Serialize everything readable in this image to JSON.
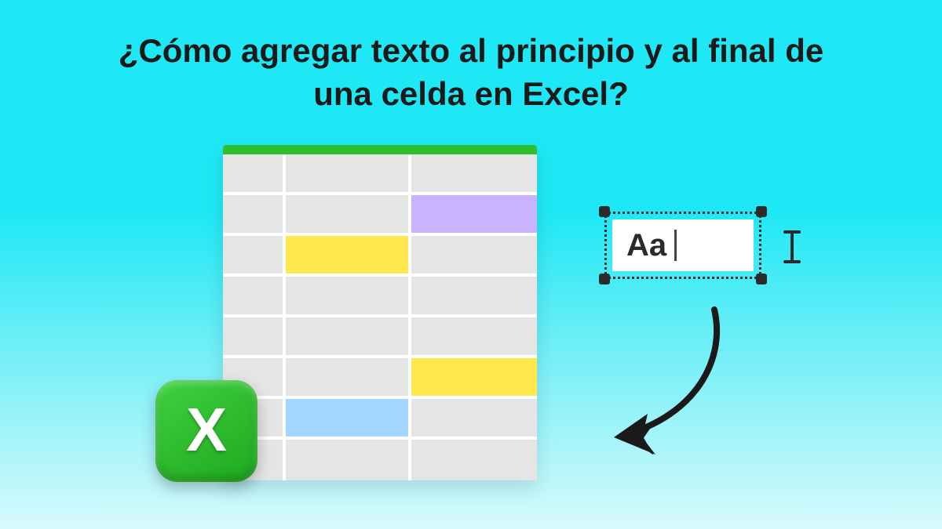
{
  "title": "¿Cómo agregar texto al principio y al final de una celda en Excel?",
  "textbox": {
    "value": "Aa"
  },
  "excel_icon": {
    "letter": "X"
  },
  "sheet": {
    "rows": [
      [
        "gray",
        "gray",
        "gray"
      ],
      [
        "gray",
        "gray",
        "purple"
      ],
      [
        "gray",
        "yellow",
        "gray"
      ],
      [
        "gray",
        "gray",
        "gray"
      ],
      [
        "gray",
        "gray",
        "gray"
      ],
      [
        "gray",
        "gray",
        "yellow"
      ],
      [
        "gray",
        "blue",
        "gray"
      ],
      [
        "gray",
        "gray",
        "gray"
      ]
    ]
  }
}
